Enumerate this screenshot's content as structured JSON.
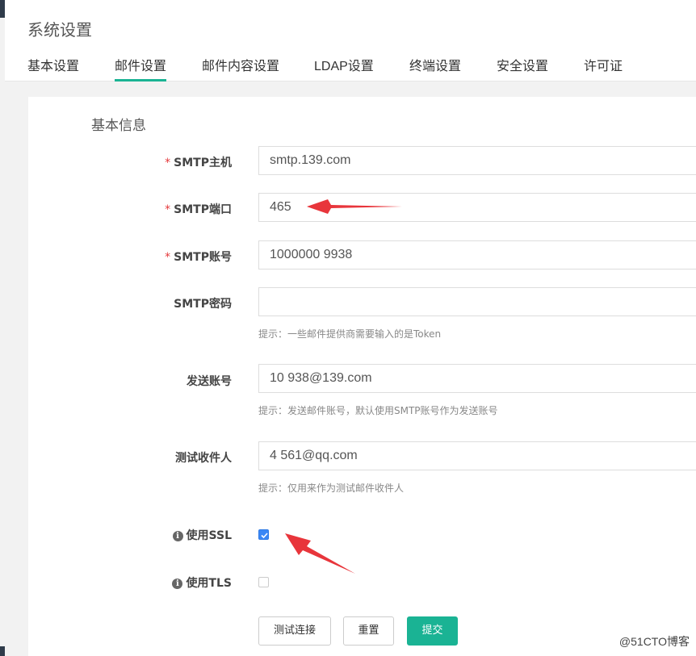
{
  "header": {
    "title": "系统设置",
    "tabs": [
      {
        "label": "基本设置"
      },
      {
        "label": "邮件设置"
      },
      {
        "label": "邮件内容设置"
      },
      {
        "label": "LDAP设置"
      },
      {
        "label": "终端设置"
      },
      {
        "label": "安全设置"
      },
      {
        "label": "许可证"
      }
    ],
    "active_tab": "邮件设置"
  },
  "form": {
    "section_title": "基本信息",
    "smtp_host": {
      "label": "SMTP主机",
      "value": "smtp.139.com"
    },
    "smtp_port": {
      "label": "SMTP端口",
      "value": "465"
    },
    "smtp_account": {
      "label": "SMTP账号",
      "value": "1000000 9938"
    },
    "smtp_password": {
      "label": "SMTP密码",
      "value": "",
      "hint": "提示：一些邮件提供商需要输入的是Token"
    },
    "sender_account": {
      "label": "发送账号",
      "value": "10 938@139.com",
      "hint": "提示：发送邮件账号，默认使用SMTP账号作为发送账号"
    },
    "test_recipient": {
      "label": "测试收件人",
      "value": "4 561@qq.com",
      "hint": "提示：仅用来作为测试邮件收件人"
    },
    "use_ssl": {
      "label": "使用SSL",
      "checked": true
    },
    "use_tls": {
      "label": "使用TLS",
      "checked": false
    },
    "buttons": {
      "test": "测试连接",
      "reset": "重置",
      "submit": "提交"
    }
  },
  "watermark": "@51CTO博客",
  "colors": {
    "accent": "#1ab394",
    "annotation_arrow": "#e8353b",
    "checkbox": "#3a87f5"
  }
}
